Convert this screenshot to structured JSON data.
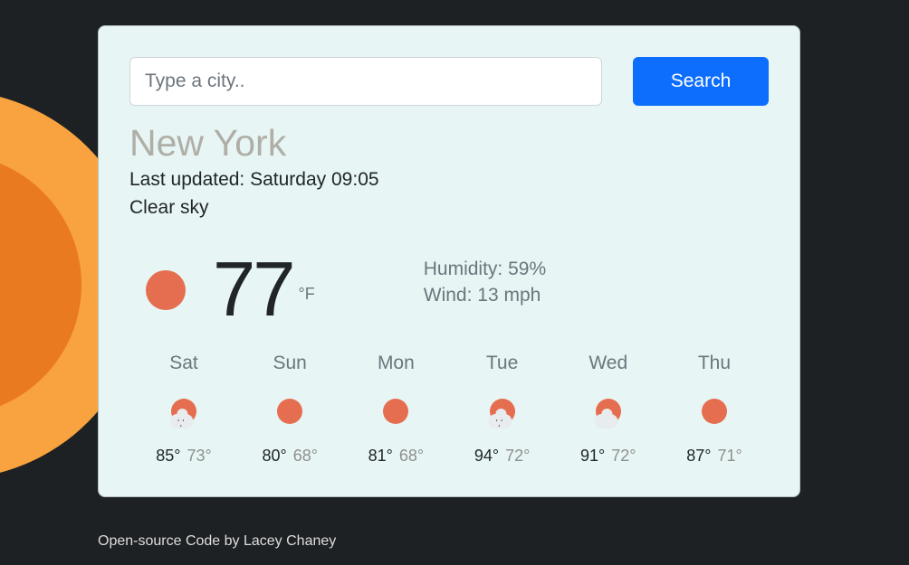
{
  "search": {
    "placeholder": "Type a city..",
    "button": "Search"
  },
  "city": "New York",
  "updated_prefix": "Last updated: ",
  "updated_time": "Saturday 09:05",
  "condition": "Clear sky",
  "temperature": "77",
  "unit": "°F",
  "humidity_label": "Humidity: ",
  "humidity": "59%",
  "wind_label": "Wind: ",
  "wind": "13 mph",
  "forecast": [
    {
      "day": "Sat",
      "hi": "85°",
      "lo": "73°",
      "icon": "rain"
    },
    {
      "day": "Sun",
      "hi": "80°",
      "lo": "68°",
      "icon": "clear"
    },
    {
      "day": "Mon",
      "hi": "81°",
      "lo": "68°",
      "icon": "clear"
    },
    {
      "day": "Tue",
      "hi": "94°",
      "lo": "72°",
      "icon": "rain"
    },
    {
      "day": "Wed",
      "hi": "91°",
      "lo": "72°",
      "icon": "cloud"
    },
    {
      "day": "Thu",
      "hi": "87°",
      "lo": "71°",
      "icon": "clear"
    }
  ],
  "footer": {
    "link": "Open-source Code",
    "mid": " by ",
    "author": "Lacey Chaney"
  }
}
